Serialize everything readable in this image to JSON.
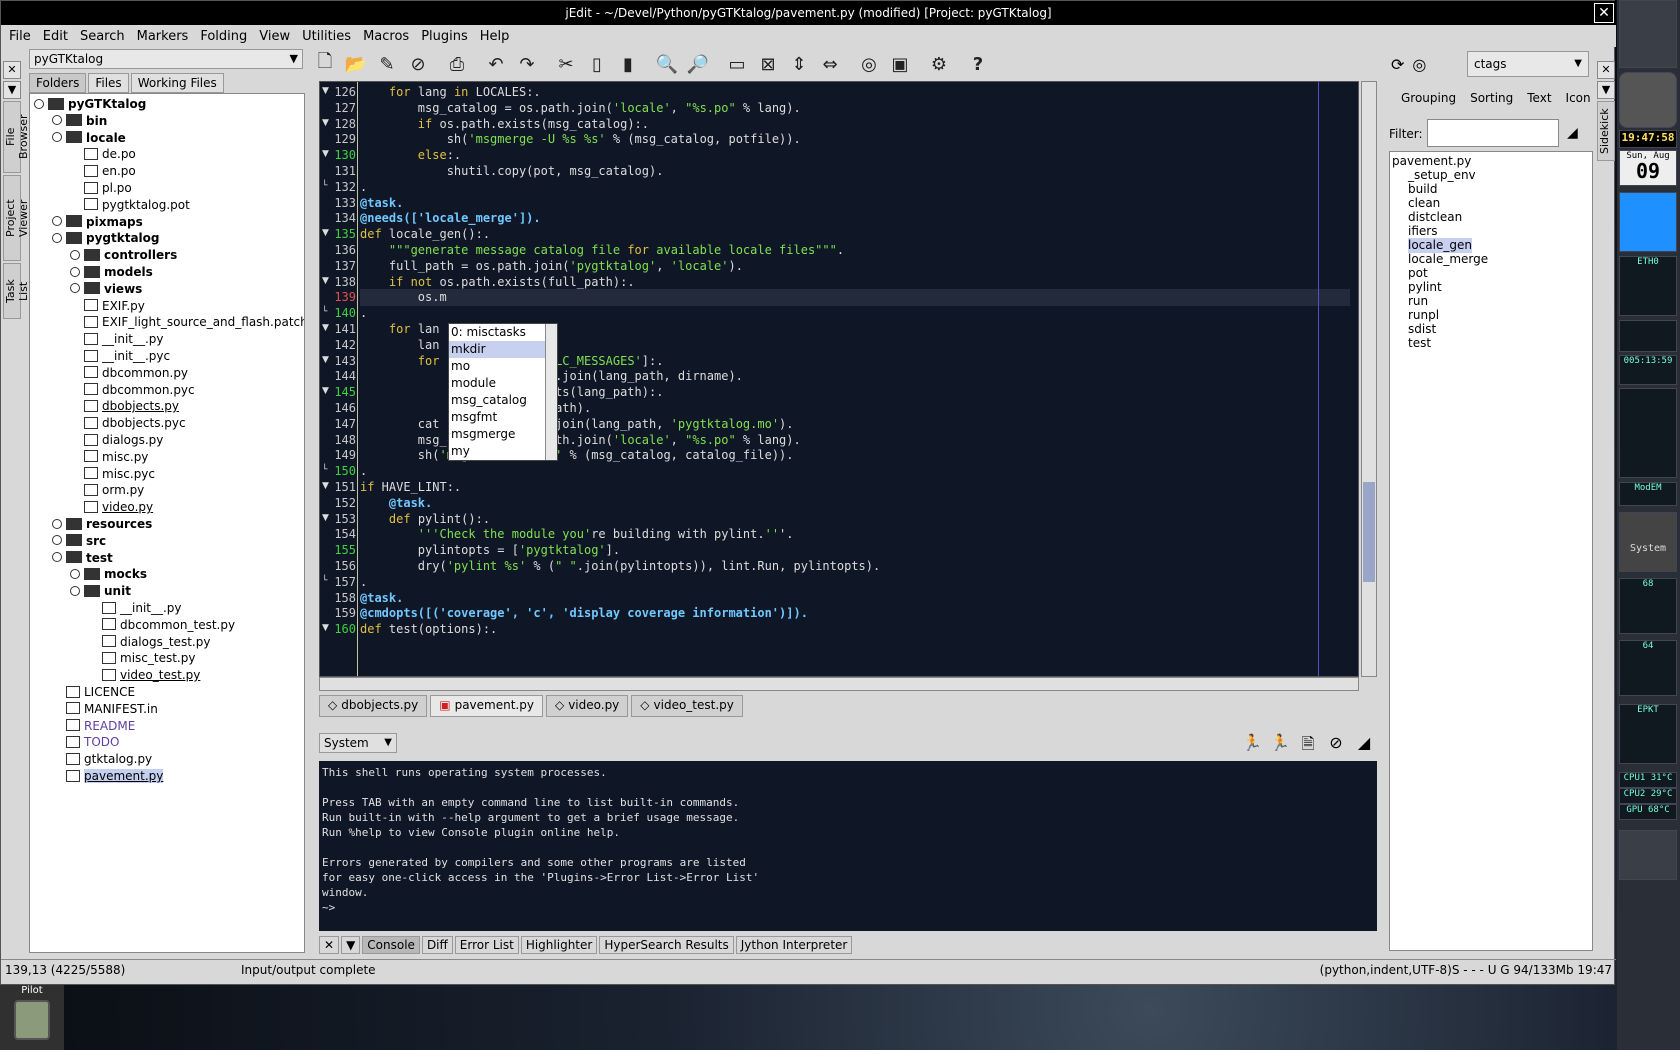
{
  "window": {
    "title": "jEdit - ~/Devel/Python/pyGTKtalog/pavement.py (modified) [Project: pyGTKtalog]",
    "close": "✕"
  },
  "menu": [
    "File",
    "Edit",
    "Search",
    "Markers",
    "Folding",
    "View",
    "Utilities",
    "Macros",
    "Plugins",
    "Help"
  ],
  "left_strip": {
    "close": "✕",
    "arrow": "▼",
    "tabs": [
      "File Browser",
      "Project Viewer",
      "Task List"
    ]
  },
  "project": {
    "selected": "pyGTKtalog",
    "tabs": [
      "Folders",
      "Files",
      "Working Files"
    ]
  },
  "tree": [
    {
      "label": "pyGTKtalog",
      "type": "root",
      "depth": 0,
      "bold": true
    },
    {
      "label": "bin",
      "type": "folder",
      "depth": 1,
      "bold": true
    },
    {
      "label": "locale",
      "type": "folder",
      "depth": 1,
      "bold": true
    },
    {
      "label": "de.po",
      "type": "file",
      "depth": 2
    },
    {
      "label": "en.po",
      "type": "file",
      "depth": 2
    },
    {
      "label": "pl.po",
      "type": "file",
      "depth": 2
    },
    {
      "label": "pygtktalog.pot",
      "type": "file",
      "depth": 2
    },
    {
      "label": "pixmaps",
      "type": "folder",
      "depth": 1,
      "bold": true
    },
    {
      "label": "pygtktalog",
      "type": "folder",
      "depth": 1,
      "bold": true
    },
    {
      "label": "controllers",
      "type": "folder",
      "depth": 2,
      "bold": true
    },
    {
      "label": "models",
      "type": "folder",
      "depth": 2,
      "bold": true
    },
    {
      "label": "views",
      "type": "folder",
      "depth": 2,
      "bold": true
    },
    {
      "label": "EXIF.py",
      "type": "file",
      "depth": 2
    },
    {
      "label": "EXIF_light_source_and_flash.patch",
      "type": "file",
      "depth": 2
    },
    {
      "label": "__init__.py",
      "type": "file",
      "depth": 2
    },
    {
      "label": "__init__.pyc",
      "type": "file",
      "depth": 2
    },
    {
      "label": "dbcommon.py",
      "type": "file",
      "depth": 2
    },
    {
      "label": "dbcommon.pyc",
      "type": "file",
      "depth": 2
    },
    {
      "label": "dbobjects.py",
      "type": "file",
      "depth": 2,
      "underline": true
    },
    {
      "label": "dbobjects.pyc",
      "type": "file",
      "depth": 2
    },
    {
      "label": "dialogs.py",
      "type": "file",
      "depth": 2
    },
    {
      "label": "misc.py",
      "type": "file",
      "depth": 2
    },
    {
      "label": "misc.pyc",
      "type": "file",
      "depth": 2
    },
    {
      "label": "orm.py",
      "type": "file",
      "depth": 2
    },
    {
      "label": "video.py",
      "type": "file",
      "depth": 2,
      "underline": true
    },
    {
      "label": "resources",
      "type": "folder",
      "depth": 1,
      "bold": true
    },
    {
      "label": "src",
      "type": "folder",
      "depth": 1,
      "bold": true
    },
    {
      "label": "test",
      "type": "folder",
      "depth": 1,
      "bold": true
    },
    {
      "label": "mocks",
      "type": "folder",
      "depth": 2,
      "bold": true
    },
    {
      "label": "unit",
      "type": "folder",
      "depth": 2,
      "bold": true
    },
    {
      "label": "__init__.py",
      "type": "file",
      "depth": 3
    },
    {
      "label": "dbcommon_test.py",
      "type": "file",
      "depth": 3
    },
    {
      "label": "dialogs_test.py",
      "type": "file",
      "depth": 3
    },
    {
      "label": "misc_test.py",
      "type": "file",
      "depth": 3
    },
    {
      "label": "video_test.py",
      "type": "file",
      "depth": 3,
      "underline": true
    },
    {
      "label": "LICENCE",
      "type": "file",
      "depth": 1
    },
    {
      "label": "MANIFEST.in",
      "type": "file",
      "depth": 1
    },
    {
      "label": "README",
      "type": "file",
      "depth": 1,
      "violet": true
    },
    {
      "label": "TODO",
      "type": "file",
      "depth": 1,
      "violet": true
    },
    {
      "label": "gtktalog.py",
      "type": "file",
      "depth": 1
    },
    {
      "label": "pavement.py",
      "type": "file",
      "depth": 1,
      "selected": true
    }
  ],
  "editor": {
    "lines": [
      {
        "n": "126",
        "t": "    for lang in LOCALES:.",
        "fold": "▼"
      },
      {
        "n": "127",
        "t": "        msg_catalog = os.path.join('locale', \"%s.po\" % lang)."
      },
      {
        "n": "128",
        "t": "        if os.path.exists(msg_catalog):.",
        "fold": "▼"
      },
      {
        "n": "129",
        "t": "            sh('msgmerge -U %s %s' % (msg_catalog, potfile))."
      },
      {
        "n": "130",
        "t": "        else:.",
        "fold": "▼",
        "green": true
      },
      {
        "n": "131",
        "t": "            shutil.copy(pot, msg_catalog)."
      },
      {
        "n": "132",
        "t": ".",
        "fold": "└"
      },
      {
        "n": "133",
        "t": "@task.",
        "deco": true
      },
      {
        "n": "134",
        "t": "@needs(['locale_merge']).",
        "deco": true
      },
      {
        "n": "135",
        "t": "def locale_gen():.",
        "fold": "▼",
        "green": true
      },
      {
        "n": "136",
        "t": "    \"\"\"generate message catalog file for available locale files\"\"\"."
      },
      {
        "n": "137",
        "t": "    full_path = os.path.join('pygtktalog', 'locale')."
      },
      {
        "n": "138",
        "t": "    if not os.path.exists(full_path):.",
        "fold": "▼"
      },
      {
        "n": "139",
        "t": "        os.m",
        "current": true
      },
      {
        "n": "140",
        "t": ".",
        "fold": "└",
        "green": true
      },
      {
        "n": "141",
        "t": "    for lan",
        "fold": "▼"
      },
      {
        "n": "142",
        "t": "        lan          path."
      },
      {
        "n": "143",
        "t": "        for          ang, 'LC_MESSAGES']:.",
        "fold": "▼"
      },
      {
        "n": "144",
        "t": "                     s.path.join(lang_path, dirname)."
      },
      {
        "n": "145",
        "t": "                     h.exists(lang_path):.",
        "fold": "▼",
        "green": true
      },
      {
        "n": "146",
        "t": "                     lang_path)."
      },
      {
        "n": "147",
        "t": "        cat          .path.join(lang_path, 'pygtktalog.mo')."
      },
      {
        "n": "148",
        "t": "        msg_catalog = os.path.join('locale', \"%s.po\" % lang)."
      },
      {
        "n": "149",
        "t": "        sh('msgfmt %s -o %s' % (msg_catalog, catalog_file))."
      },
      {
        "n": "150",
        "t": ".",
        "fold": "└",
        "green": true
      },
      {
        "n": "151",
        "t": "if HAVE_LINT:.",
        "fold": "▼"
      },
      {
        "n": "152",
        "t": "    @task.",
        "deco": true
      },
      {
        "n": "153",
        "t": "    def pylint():.",
        "fold": "▼"
      },
      {
        "n": "154",
        "t": "        '''Check the module you're building with pylint.'''."
      },
      {
        "n": "155",
        "t": "        pylintopts = ['pygtktalog'].",
        "green": true
      },
      {
        "n": "156",
        "t": "        dry('pylint %s' % (\" \".join(pylintopts)), lint.Run, pylintopts)."
      },
      {
        "n": "157",
        "t": ".",
        "fold": "└"
      },
      {
        "n": "158",
        "t": "@task.",
        "deco": true
      },
      {
        "n": "159",
        "t": "@cmdopts([('coverage', 'c', 'display coverage information')]).",
        "deco": true
      },
      {
        "n": "160",
        "t": "def test(options):.",
        "fold": "▼",
        "green": true
      }
    ],
    "completion": [
      "0: misctasks",
      "mkdir",
      "mo",
      "module",
      "msg_catalog",
      "msgfmt",
      "msgmerge",
      "my"
    ],
    "completion_selected": 1
  },
  "buffers": [
    {
      "label": "dbobjects.py",
      "icon": "◇"
    },
    {
      "label": "pavement.py",
      "icon": "▣",
      "active": true
    },
    {
      "label": "video.py",
      "icon": "◇"
    },
    {
      "label": "video_test.py",
      "icon": "◇"
    }
  ],
  "console": {
    "selector": "System",
    "text": "This shell runs operating system processes.\n\nPress TAB with an empty command line to list built-in commands.\nRun built-in with --help argument to get a brief usage message.\nRun %help to view Console plugin online help.\n\nErrors generated by compilers and some other programs are listed\nfor easy one-click access in the 'Plugins->Error List->Error List'\nwindow.\n~>",
    "tabs": [
      "Console",
      "Diff",
      "Error List",
      "Highlighter",
      "HyperSearch Results",
      "Jython Interpreter"
    ],
    "close": "✕",
    "arrow": "▼"
  },
  "status": {
    "position": "139,13 (4225/5588)",
    "message": "Input/output complete",
    "mode": "(python,indent,UTF-8)S - - - U G 94/133Mb 19:47"
  },
  "sidekick": {
    "parser": "ctags",
    "tabs": [
      "Grouping",
      "Sorting",
      "Text",
      "Icon"
    ],
    "filter_label": "Filter:",
    "vtab": "Sidekick",
    "close": "✕",
    "arrow": "▼",
    "items": [
      {
        "label": "pavement.py",
        "depth": 0
      },
      {
        "label": "_setup_env",
        "depth": 1
      },
      {
        "label": "build",
        "depth": 1
      },
      {
        "label": "clean",
        "depth": 1
      },
      {
        "label": "distclean",
        "depth": 1
      },
      {
        "label": "ifiers",
        "depth": 1
      },
      {
        "label": "locale_gen",
        "depth": 1,
        "selected": true
      },
      {
        "label": "locale_merge",
        "depth": 1
      },
      {
        "label": "pot",
        "depth": 1
      },
      {
        "label": "pylint",
        "depth": 1
      },
      {
        "label": "run",
        "depth": 1
      },
      {
        "label": "runpl",
        "depth": 1
      },
      {
        "label": "sdist",
        "depth": 1
      },
      {
        "label": "test",
        "depth": 1
      }
    ]
  },
  "dock": {
    "clock": "19:47:58",
    "day": "Sun, Aug",
    "date": "09",
    "pilot": "Pilot",
    "eth": "ETH0",
    "time2": "005:13:59",
    "mode": "ModEM",
    "temp1": "68",
    "temp2": "64",
    "cpu1": "CPU1 31°C",
    "cpu2": "CPU2 29°C",
    "gpu": "GPU 68°C",
    "epkt": "EPKT",
    "system": "System"
  }
}
